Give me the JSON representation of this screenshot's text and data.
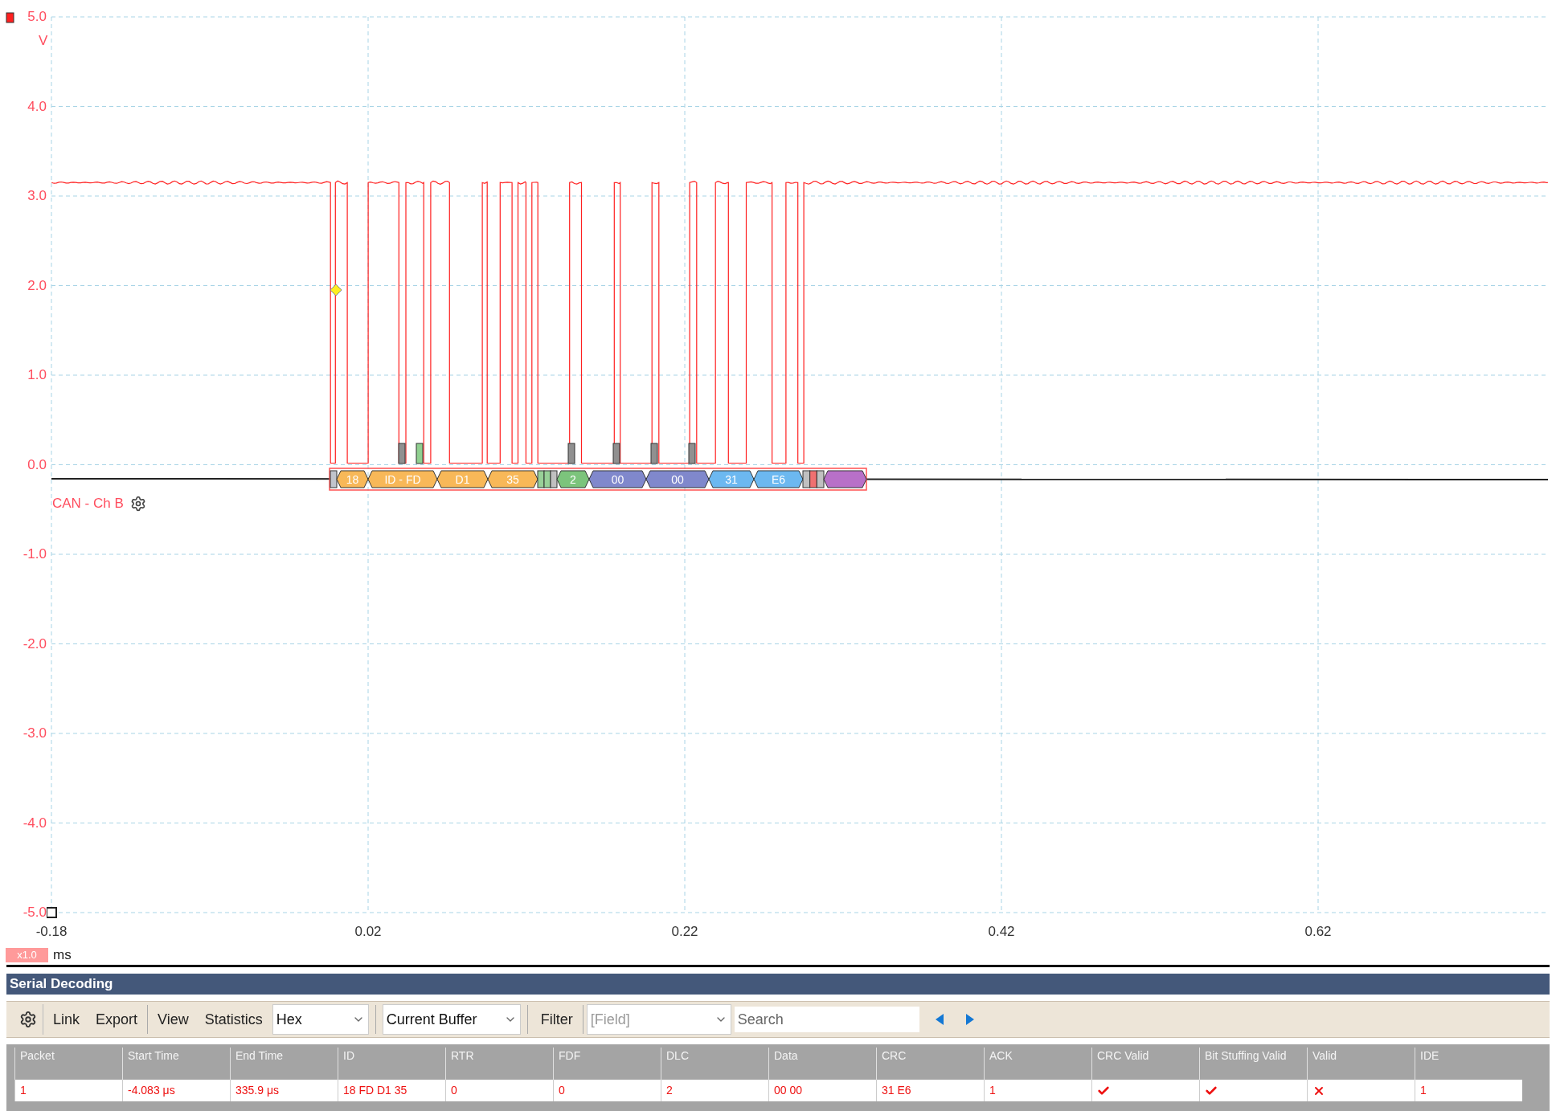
{
  "scope": {
    "y_axis": {
      "unit": "V",
      "ticks": [
        "5.0",
        "4.0",
        "3.0",
        "2.0",
        "1.0",
        "0.0",
        "-1.0",
        "-2.0",
        "-3.0",
        "-4.0",
        "-5.0"
      ]
    },
    "x_axis": {
      "unit": "ms",
      "zoom": "x1.0",
      "ticks": [
        "-0.18",
        "0.02",
        "0.22",
        "0.42",
        "0.62"
      ]
    },
    "channel": {
      "label": "CAN - Ch B",
      "color": "#ff2020"
    },
    "stuff_markers": [
      {
        "color": "#909090"
      },
      {
        "color": "#90d090"
      },
      {
        "color": "#909090"
      },
      {
        "color": "#909090"
      },
      {
        "color": "#909090"
      },
      {
        "color": "#909090"
      }
    ],
    "decode": [
      {
        "kind": "bits",
        "bits": [
          {
            "color": "#c0c4cc"
          }
        ]
      },
      {
        "kind": "field",
        "label": "18",
        "color": "#f8b858"
      },
      {
        "kind": "field",
        "label": "ID - FD",
        "color": "#f8b858"
      },
      {
        "kind": "field",
        "label": "D1",
        "color": "#f8b858"
      },
      {
        "kind": "field",
        "label": "35",
        "color": "#f8b858"
      },
      {
        "kind": "bits",
        "bits": [
          {
            "color": "#98d098"
          },
          {
            "color": "#98d098"
          },
          {
            "color": "#c0c0c0"
          }
        ]
      },
      {
        "kind": "field",
        "label": "2",
        "color": "#7cc47c"
      },
      {
        "kind": "field",
        "label": "00",
        "color": "#8088cc"
      },
      {
        "kind": "field",
        "label": "00",
        "color": "#8088cc"
      },
      {
        "kind": "field",
        "label": "31",
        "color": "#6cb8f0"
      },
      {
        "kind": "field",
        "label": "E6",
        "color": "#6cb8f0"
      },
      {
        "kind": "bits",
        "bits": [
          {
            "color": "#c0c0c0"
          },
          {
            "color": "#f07070"
          },
          {
            "color": "#c0c0c0"
          }
        ]
      },
      {
        "kind": "field",
        "color": "#b870c8"
      }
    ]
  },
  "panel": {
    "title": "Serial Decoding",
    "toolbar": {
      "buttons": [
        "Link",
        "Export",
        "View",
        "Statistics"
      ],
      "format": "Hex",
      "buffer": "Current Buffer",
      "filter": "Filter",
      "field": {
        "placeholder": "[Field]"
      },
      "search": {
        "placeholder": "Search"
      }
    },
    "table": {
      "columns": [
        "Packet",
        "Start Time",
        "End Time",
        "ID",
        "RTR",
        "FDF",
        "DLC",
        "Data",
        "CRC",
        "ACK",
        "CRC Valid",
        "Bit Stuffing Valid",
        "Valid",
        "IDE"
      ],
      "rows": [
        {
          "cells": [
            {
              "kind": "text",
              "text": "1"
            },
            {
              "kind": "text",
              "text": "-4.083 μs"
            },
            {
              "kind": "text",
              "text": "335.9 μs"
            },
            {
              "kind": "text",
              "text": "18 FD D1 35"
            },
            {
              "kind": "text",
              "text": "0"
            },
            {
              "kind": "text",
              "text": "0"
            },
            {
              "kind": "text",
              "text": "2"
            },
            {
              "kind": "text",
              "text": "00 00"
            },
            {
              "kind": "text",
              "text": "31 E6"
            },
            {
              "kind": "text",
              "text": "1"
            },
            {
              "kind": "check",
              "valid": true
            },
            {
              "kind": "check",
              "valid": true
            },
            {
              "kind": "check",
              "valid": false
            },
            {
              "kind": "text",
              "text": "1"
            }
          ]
        }
      ]
    }
  }
}
